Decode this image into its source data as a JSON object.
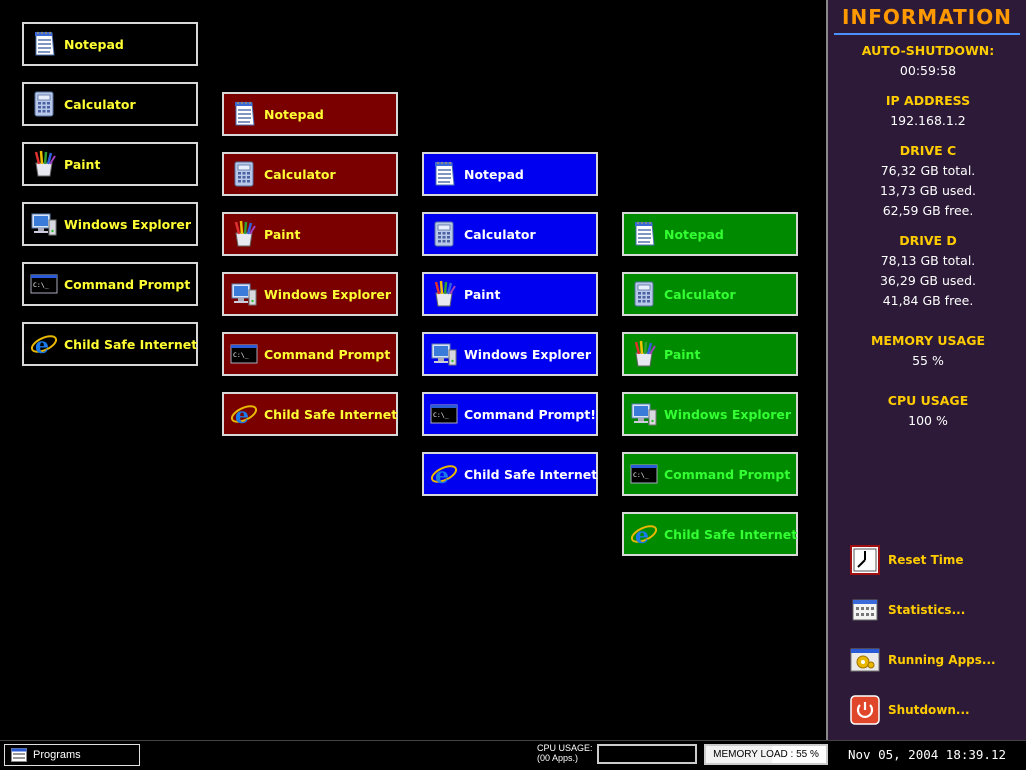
{
  "app_columns": [
    {
      "theme": "black",
      "items": [
        {
          "label": "Notepad",
          "icon": "notepad-icon"
        },
        {
          "label": "Calculator",
          "icon": "calculator-icon"
        },
        {
          "label": "Paint",
          "icon": "paint-icon"
        },
        {
          "label": "Windows Explorer",
          "icon": "windows-explorer-icon"
        },
        {
          "label": "Command Prompt",
          "icon": "command-prompt-icon"
        },
        {
          "label": "Child Safe Internet",
          "icon": "internet-explorer-icon"
        }
      ]
    },
    {
      "theme": "red",
      "items": [
        {
          "label": "Notepad",
          "icon": "notepad-icon"
        },
        {
          "label": "Calculator",
          "icon": "calculator-icon"
        },
        {
          "label": "Paint",
          "icon": "paint-icon"
        },
        {
          "label": "Windows Explorer",
          "icon": "windows-explorer-icon"
        },
        {
          "label": "Command Prompt",
          "icon": "command-prompt-icon"
        },
        {
          "label": "Child Safe Internet",
          "icon": "internet-explorer-icon"
        }
      ]
    },
    {
      "theme": "blue",
      "items": [
        {
          "label": "Notepad",
          "icon": "notepad-icon"
        },
        {
          "label": "Calculator",
          "icon": "calculator-icon"
        },
        {
          "label": "Paint",
          "icon": "paint-icon"
        },
        {
          "label": "Windows Explorer",
          "icon": "windows-explorer-icon"
        },
        {
          "label": "Command Prompt!",
          "icon": "command-prompt-icon"
        },
        {
          "label": "Child Safe Internet",
          "icon": "internet-explorer-icon"
        }
      ]
    },
    {
      "theme": "green",
      "items": [
        {
          "label": "Notepad",
          "icon": "notepad-icon"
        },
        {
          "label": "Calculator",
          "icon": "calculator-icon"
        },
        {
          "label": "Paint",
          "icon": "paint-icon"
        },
        {
          "label": "Windows Explorer",
          "icon": "windows-explorer-icon"
        },
        {
          "label": "Command Prompt",
          "icon": "command-prompt-icon"
        },
        {
          "label": "Child Safe Internet",
          "icon": "internet-explorer-icon"
        }
      ]
    }
  ],
  "info": {
    "title": "INFORMATION",
    "auto_shutdown": {
      "label": "AUTO-SHUTDOWN:",
      "value": "00:59:58"
    },
    "ip": {
      "label": "IP ADDRESS",
      "value": "192.168.1.2"
    },
    "drive_c": {
      "label": "DRIVE C",
      "total": "76,32 GB total.",
      "used": "13,73 GB used.",
      "free": "62,59 GB free."
    },
    "drive_d": {
      "label": "DRIVE D",
      "total": "78,13 GB total.",
      "used": "36,29 GB used.",
      "free": "41,84 GB free."
    },
    "memory": {
      "label": "MEMORY USAGE",
      "value": "55 %"
    },
    "cpu": {
      "label": "CPU USAGE",
      "value": "100 %"
    },
    "actions": [
      {
        "label": "Reset Time",
        "icon": "clock-icon"
      },
      {
        "label": "Statistics...",
        "icon": "statistics-icon"
      },
      {
        "label": "Running Apps...",
        "icon": "running-apps-icon"
      },
      {
        "label": "Shutdown...",
        "icon": "power-icon"
      }
    ]
  },
  "taskbar": {
    "programs_label": "Programs",
    "cpu_label_line1": "CPU USAGE:",
    "cpu_label_line2": "(00 Apps.)",
    "cpu_level_percent": 100,
    "memory_text": "MEMORY LOAD : 55 %",
    "memory_level_percent": 55,
    "clock": "Nov 05, 2004 18:39.12"
  },
  "colors": {
    "theme_black": "#000000",
    "theme_red": "#7a0000",
    "theme_blue": "#0000f0",
    "theme_green": "#008a00",
    "panel_bg": "#2c1a38",
    "panel_title": "#ff9900",
    "panel_heading": "#ffcc00"
  }
}
